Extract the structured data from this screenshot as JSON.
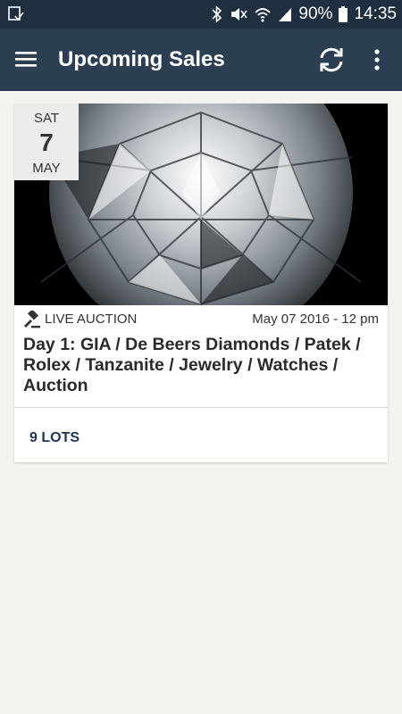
{
  "status_bar": {
    "battery_percent": "90%",
    "time": "14:35",
    "icons": [
      "download-done-icon",
      "bluetooth-icon",
      "mute-icon",
      "wifi-icon",
      "signal-icon",
      "battery-icon"
    ]
  },
  "app_bar": {
    "title": "Upcoming Sales",
    "icons": [
      "menu-icon",
      "refresh-icon",
      "more-vert-icon"
    ]
  },
  "sales": [
    {
      "date_badge": {
        "day_of_week": "SAT",
        "day": "7",
        "month": "MAY"
      },
      "auction_type": "LIVE AUCTION",
      "date_time": "May 07 2016 - 12 pm",
      "title": "Day 1: GIA / De Beers Diamonds / Patek / Rolex / Tanzanite / Jewelry / Watches / Auction",
      "lots_label": "9 LOTS",
      "image": "diamond-photo"
    }
  ],
  "colors": {
    "status_bar": "#1f2f40",
    "app_bar": "#2c3e52",
    "background": "#f4f3ef",
    "accent_text": "#1f3552"
  }
}
